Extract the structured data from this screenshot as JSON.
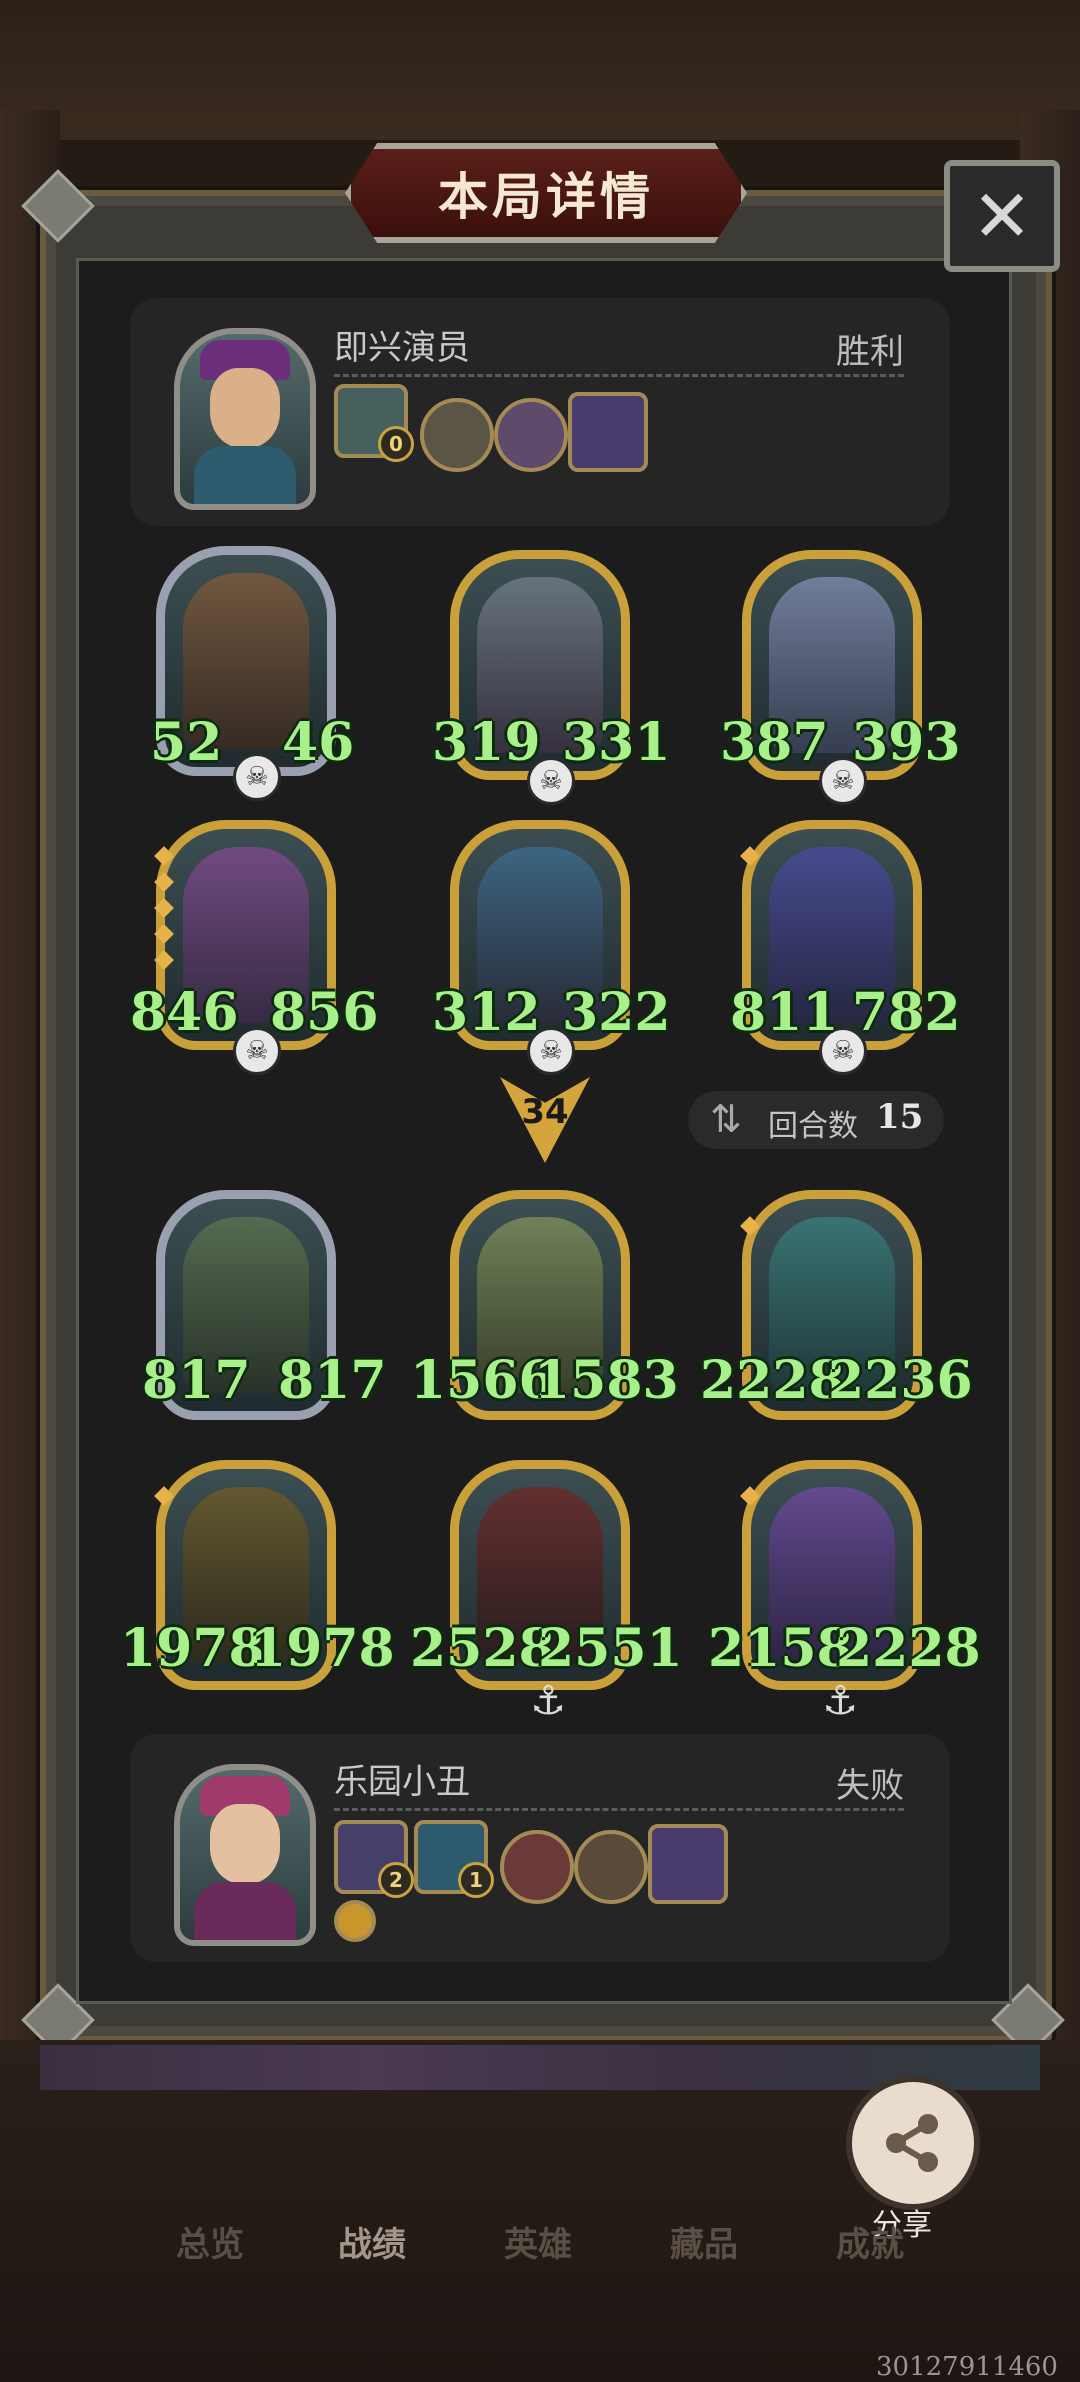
{
  "dialog": {
    "title": "本局详情",
    "close_label": "✕"
  },
  "player1": {
    "name": "即兴演员",
    "result": "胜利",
    "item_level": "0"
  },
  "board": {
    "row1": [
      {
        "atk": "52",
        "hp": "46",
        "frame": "silver"
      },
      {
        "atk": "319",
        "hp": "331",
        "frame": "gold"
      },
      {
        "atk": "387",
        "hp": "393",
        "frame": "gold"
      }
    ],
    "row2": [
      {
        "atk": "846",
        "hp": "856",
        "frame": "gold"
      },
      {
        "atk": "312",
        "hp": "322",
        "frame": "gold"
      },
      {
        "atk": "811",
        "hp": "782",
        "frame": "gold"
      }
    ],
    "tier": "34",
    "turns_label": "回合数",
    "turns_value": "15",
    "row3": [
      {
        "atk": "817",
        "hp": "817",
        "frame": "silver"
      },
      {
        "atk": "1566",
        "hp": "1583",
        "frame": "gold"
      },
      {
        "atk": "2228",
        "hp": "2236",
        "frame": "gold"
      }
    ],
    "row4": [
      {
        "atk": "1978",
        "hp": "1978",
        "frame": "gold"
      },
      {
        "atk": "2528",
        "hp": "2551",
        "frame": "gold"
      },
      {
        "atk": "2158",
        "hp": "2228",
        "frame": "gold"
      }
    ]
  },
  "player2": {
    "name": "乐园小丑",
    "result": "失败",
    "item_level_1": "2",
    "item_level_2": "1"
  },
  "share": {
    "label": "分享",
    "icon": "share-icon"
  },
  "tabs": [
    "总览",
    "战绩",
    "英雄",
    "藏品",
    "成就"
  ],
  "uid": "30127911460",
  "colors": {
    "stat_green": "#a7f08a",
    "gold_frame": "#c9a03a",
    "title_red": "#5a1f18"
  }
}
